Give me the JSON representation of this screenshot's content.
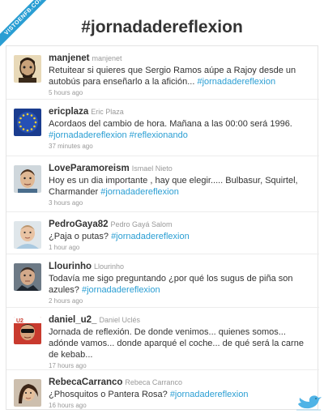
{
  "site": {
    "ribbon": "VISTOENFB.COM"
  },
  "title": "#jornadadereflexion",
  "tweets": [
    {
      "user": "manjenet",
      "name": "manjenet",
      "text": "Retuitear si quieres que Sergio Ramos aúpe a Rajoy desde un autobús para enseñarlo a la afición... ",
      "hashtags": "#jornadadereflexion",
      "time": "5 hours ago"
    },
    {
      "user": "ericplaza",
      "name": "Eric Plaza",
      "text": "Acordaos del cambio de hora. Mañana a las 00:00 será 1996. ",
      "hashtags": "#jornadadereflexion #reflexionando",
      "time": "37 minutes ago"
    },
    {
      "user": "LoveParamoreism",
      "name": "Ismael Nieto",
      "text": "Hoy es un dia importante , hay que elegir..... Bulbasur, Squirtel, Charmander ",
      "hashtags": "#jornadadereflexion",
      "time": "3 hours ago"
    },
    {
      "user": "PedroGaya82",
      "name": "Pedro Gayá Salom",
      "text": "¿Paja o putas? ",
      "hashtags": "#jornadadereflexion",
      "time": "1 hour ago"
    },
    {
      "user": "Llourinho",
      "name": "Llourinho",
      "text": "Todavía me sigo preguntando ¿por qué los sugus de piña son azules? ",
      "hashtags": "#jornadadereflexion",
      "time": "2 hours ago"
    },
    {
      "user": "daniel_u2_",
      "name": "Daniel Uclés",
      "text": "Jornada de reflexión. De donde venimos... quienes somos... adónde vamos... donde aparqué el coche... de qué será la carne de kebab...",
      "hashtags": "",
      "time": "17 hours ago"
    },
    {
      "user": "RebecaCarranco",
      "name": "Rebeca Carranco",
      "text": "¿Phosquitos o Pantera Rosa? ",
      "hashtags": "#jornadadereflexion",
      "time": "16 hours ago"
    }
  ]
}
